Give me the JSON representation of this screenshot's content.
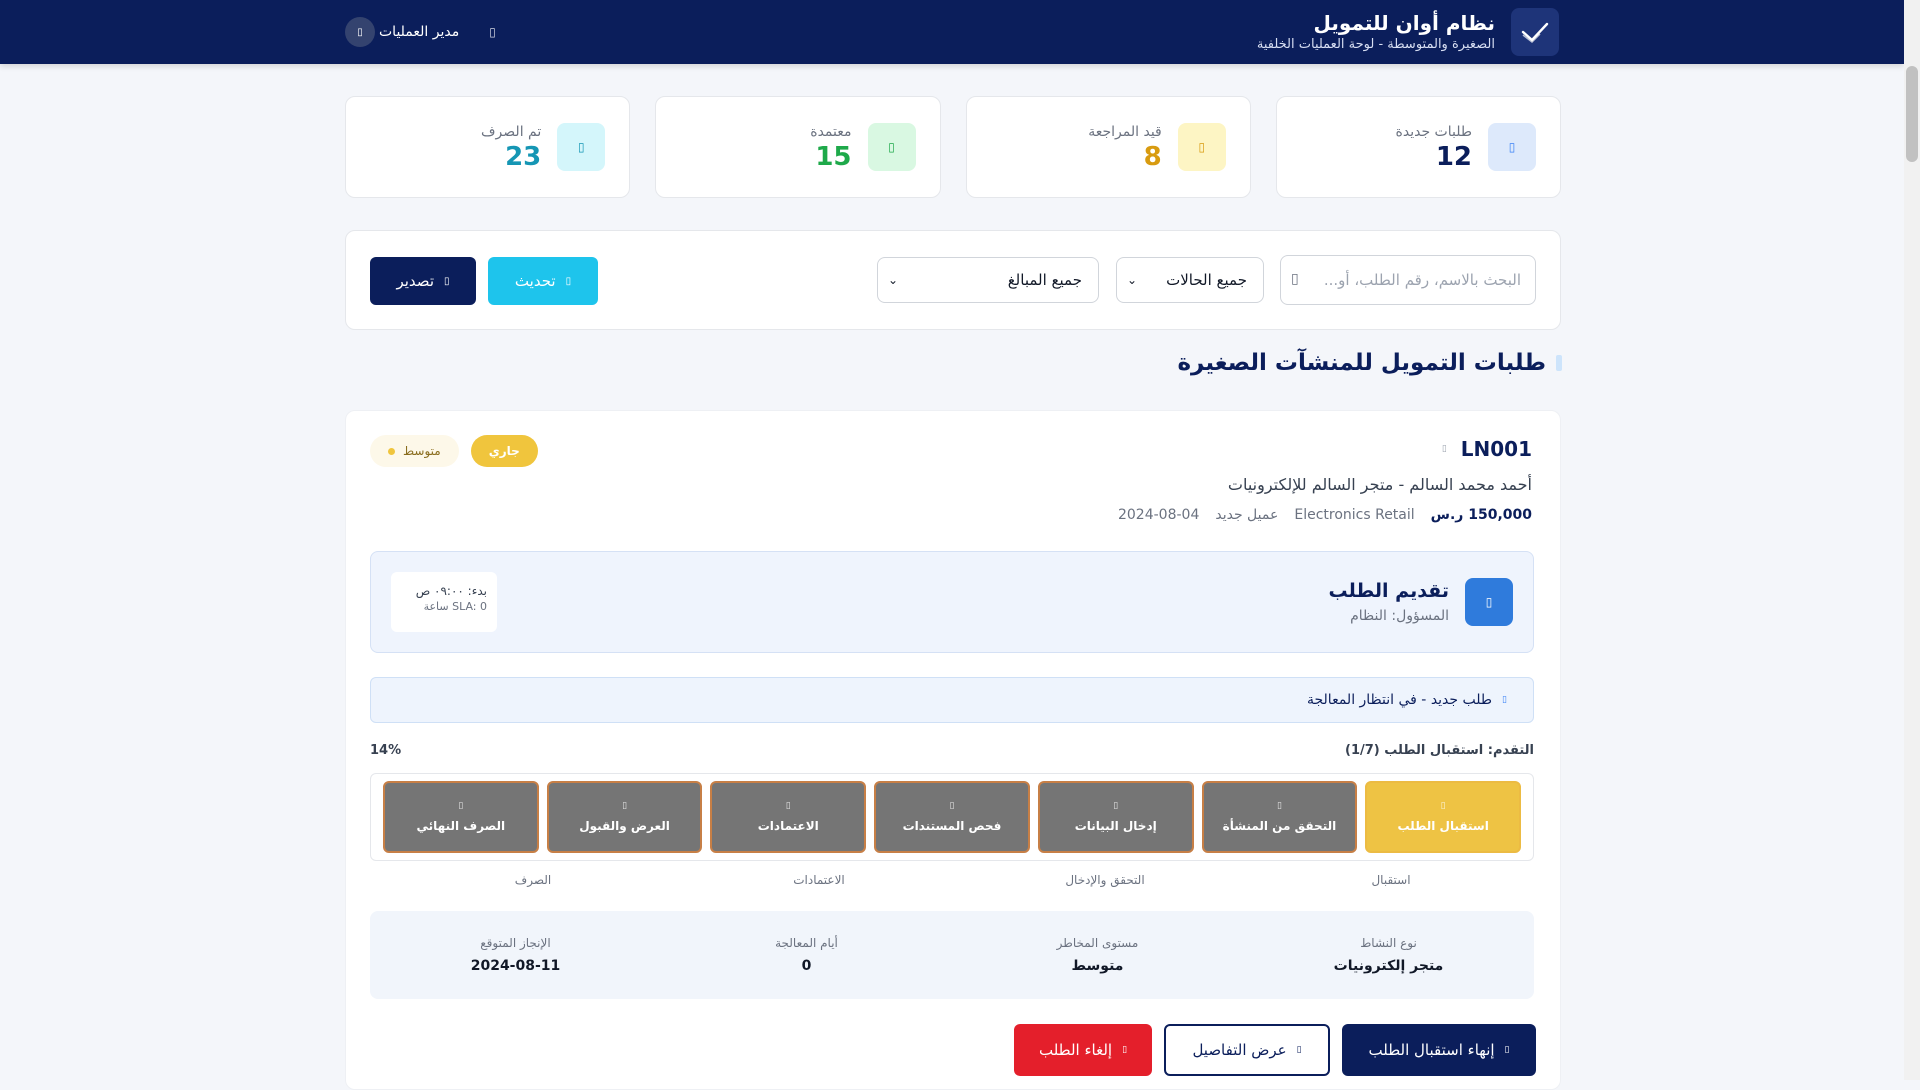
{
  "header": {
    "title": "نظام أوان للتمويل",
    "subtitle": "الصغيرة والمتوسطة - لوحة العمليات الخلفية",
    "user_name": "مدير العمليات"
  },
  "stats": [
    {
      "label": "طلبات جديدة",
      "value": "12",
      "color": "#0b1e5b",
      "icon_bg": "#dde9fb",
      "icon": "file-icon"
    },
    {
      "label": "قيد المراجعة",
      "value": "8",
      "color": "#d89b10",
      "icon_bg": "#fdf5c4",
      "icon": "clock-icon"
    },
    {
      "label": "معتمدة",
      "value": "15",
      "color": "#1ea94a",
      "icon_bg": "#d9f8e2",
      "icon": "check-icon"
    },
    {
      "label": "تم الصرف",
      "value": "23",
      "color": "#1596b4",
      "icon_bg": "#d4f6fb",
      "icon": "money-icon"
    }
  ],
  "filters": {
    "search_placeholder": "البحث بالاسم، رقم الطلب، أو...",
    "status_select": "جميع الحالات",
    "amount_select": "جميع المبالغ",
    "refresh_label": "تحديث",
    "export_label": "تصدير"
  },
  "section": {
    "title": "طلبات التمويل للمنشآت الصغيرة"
  },
  "request": {
    "id": "LN001",
    "status": "جاري",
    "risk": "متوسط",
    "applicant": "أحمد محمد السالم - متجر السالم للإلكترونيات",
    "amount": "150,000 ر.س",
    "sector": "Electronics Retail",
    "customer_type": "عميل جديد",
    "date": "2024-08-04",
    "stage": {
      "title": "تقديم الطلب",
      "owner": "المسؤول: النظام",
      "started": "بدء: ٠٩:٠٠ ص",
      "sla": "SLA: 0 ساعة"
    },
    "alert": "طلب جديد - في انتظار المعالجة",
    "progress_label": "التقدم: استقبال الطلب (1/7)",
    "progress_percent": "14%",
    "progress_value": 14,
    "steps": [
      {
        "label": "استقبال الطلب",
        "active": true
      },
      {
        "label": "التحقق من المنشأة",
        "active": false
      },
      {
        "label": "إدخال البيانات",
        "active": false
      },
      {
        "label": "فحص المستندات",
        "active": false
      },
      {
        "label": "الاعتمادات",
        "active": false
      },
      {
        "label": "العرض والقبول",
        "active": false
      },
      {
        "label": "الصرف النهائي",
        "active": false
      }
    ],
    "groups": [
      "استقبال",
      "التحقق والإدخال",
      "الاعتمادات",
      "الصرف"
    ],
    "details": [
      {
        "label": "نوع النشاط",
        "value": "متجر إلكترونيات"
      },
      {
        "label": "مستوى المخاطر",
        "value": "متوسط"
      },
      {
        "label": "أيام المعالجة",
        "value": "0"
      },
      {
        "label": "الإنجاز المتوقع",
        "value": "2024-08-11"
      }
    ],
    "actions": {
      "finish": "إنهاء استقبال الطلب",
      "details": "عرض التفاصيل",
      "cancel": "إلغاء الطلب"
    }
  }
}
